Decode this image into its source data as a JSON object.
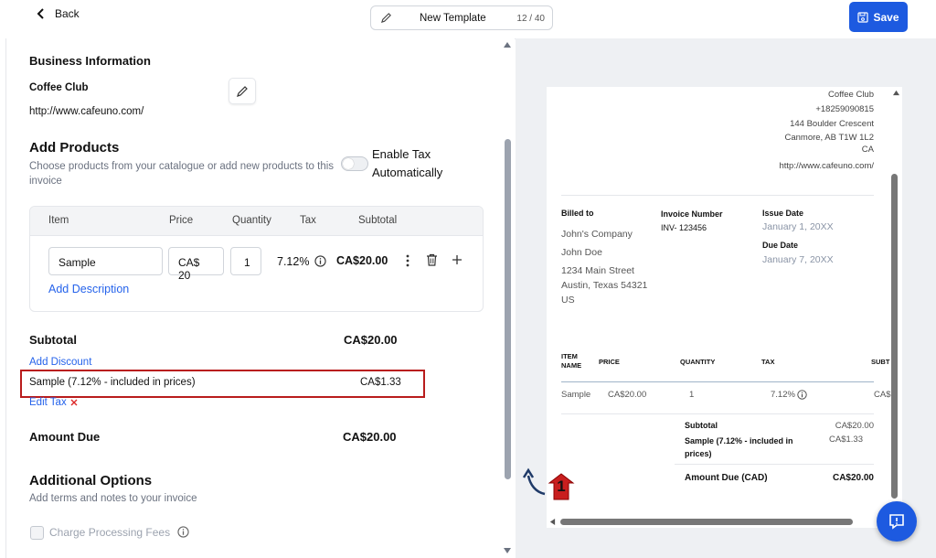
{
  "topbar": {
    "back_label": "Back",
    "template_name": "New Template",
    "template_count": "12 / 40",
    "save_label": "Save"
  },
  "business": {
    "section_title": "Business Information",
    "name": "Coffee Club",
    "website": "http://www.cafeuno.com/"
  },
  "products": {
    "section_title": "Add Products",
    "description": "Choose products from your catalogue or add new products to this invoice",
    "enable_tax_label": "Enable Tax Automatically",
    "headers": [
      "Item",
      "Price",
      "Quantity",
      "Tax",
      "Subtotal"
    ],
    "row": {
      "item": "Sample",
      "price": "CA$ 20",
      "quantity": "1",
      "tax": "7.12%",
      "subtotal": "CA$20.00"
    },
    "add_description": "Add Description"
  },
  "totals": {
    "subtotal_label": "Subtotal",
    "subtotal_value": "CA$20.00",
    "add_discount": "Add Discount",
    "tax_line_label": "Sample (7.12% - included in prices)",
    "tax_line_value": "CA$1.33",
    "edit_tax": "Edit Tax",
    "amount_due_label": "Amount Due",
    "amount_due_value": "CA$20.00"
  },
  "additional": {
    "section_title": "Additional Options",
    "description": "Add terms and notes to your invoice",
    "charge_fees_label": "Charge Processing Fees"
  },
  "annotation": {
    "step_number": "1"
  },
  "preview": {
    "company_name": "Coffee Club",
    "phone": "+18259090815",
    "address_line1": "144 Boulder Crescent",
    "address_line2": "Canmore, AB T1W 1L2",
    "country": "CA",
    "website": "http://www.cafeuno.com/",
    "billed_to_label": "Billed to",
    "billed_company": "John's Company",
    "billed_name": "John Doe",
    "billed_street": "1234 Main Street",
    "billed_city": "Austin, Texas 54321",
    "billed_country": "US",
    "invoice_number_label": "Invoice Number",
    "invoice_number": "INV- 123456",
    "issue_date_label": "Issue Date",
    "issue_date": "January 1, 20XX",
    "due_date_label": "Due Date",
    "due_date": "January 7, 20XX",
    "col_item_line1": "ITEM",
    "col_item_line2": "NAME",
    "col_price": "PRICE",
    "col_quantity": "QUANTITY",
    "col_tax": "TAX",
    "col_subtotal": "SUBT",
    "row_item": "Sample",
    "row_price": "CA$20.00",
    "row_quantity": "1",
    "row_tax": "7.12%",
    "row_subtotal": "CA$",
    "subtotal_label": "Subtotal",
    "subtotal_value": "CA$20.00",
    "tax_label_line1": "Sample (7.12% - included in",
    "tax_label_line2": "prices)",
    "tax_value": "CA$1.33",
    "amount_due_label": "Amount Due (CAD)",
    "amount_due_value": "CA$20.00"
  },
  "colors": {
    "accent": "#1d5ae0",
    "link": "#2563eb",
    "highlight": "#b91c1c"
  }
}
